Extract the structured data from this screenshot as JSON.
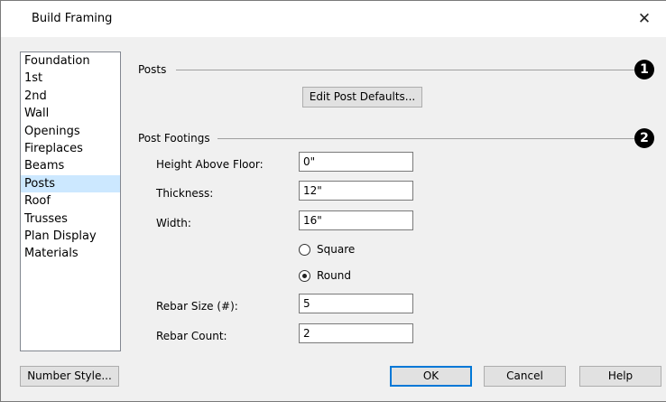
{
  "dialog": {
    "title": "Build Framing",
    "close_glyph": "✕"
  },
  "categories": {
    "items": [
      "Foundation",
      "1st",
      "2nd",
      "Wall",
      "Openings",
      "Fireplaces",
      "Beams",
      "Posts",
      "Roof",
      "Trusses",
      "Plan Display",
      "Materials"
    ],
    "selected": "Posts"
  },
  "posts": {
    "section_label": "Posts",
    "callout": "1",
    "edit_defaults_label": "Edit Post Defaults..."
  },
  "post_footings": {
    "section_label": "Post Footings",
    "callout": "2",
    "height_above_floor": {
      "label": "Height Above Floor:",
      "value": "0\""
    },
    "thickness": {
      "label": "Thickness:",
      "value": "12\""
    },
    "width": {
      "label": "Width:",
      "value": "16\""
    },
    "shape": {
      "square_label": "Square",
      "round_label": "Round",
      "selected": "Round"
    },
    "rebar_size": {
      "label": "Rebar Size (#):",
      "value": "5"
    },
    "rebar_count": {
      "label": "Rebar Count:",
      "value": "2"
    }
  },
  "footer": {
    "number_style_label": "Number Style...",
    "ok_label": "OK",
    "cancel_label": "Cancel",
    "help_label": "Help"
  }
}
